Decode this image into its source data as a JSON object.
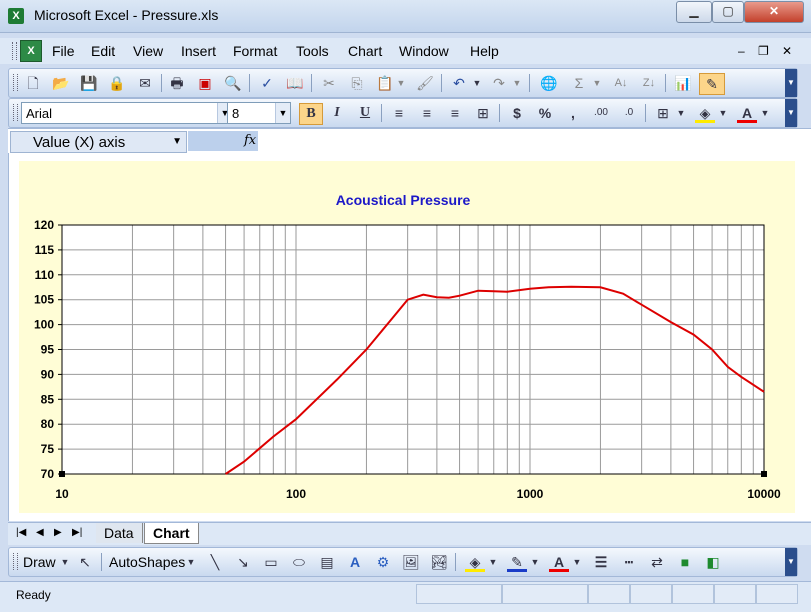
{
  "window": {
    "title": "Microsoft Excel - Pressure.xls",
    "app_icon": "X"
  },
  "menu": {
    "items": [
      {
        "label": "File",
        "u": "F",
        "rest": "ile"
      },
      {
        "label": "Edit",
        "u": "E",
        "rest": "dit"
      },
      {
        "label": "View",
        "u": "V",
        "rest": "iew"
      },
      {
        "label": "Insert",
        "u": "I",
        "rest": "nsert"
      },
      {
        "label": "Format",
        "u": "o",
        "pre": "F",
        "rest": "rmat"
      },
      {
        "label": "Tools",
        "u": "T",
        "rest": "ools"
      },
      {
        "label": "Chart",
        "u": "C",
        "rest": "hart"
      },
      {
        "label": "Window",
        "u": "W",
        "rest": "indow"
      },
      {
        "label": "Help",
        "u": "H",
        "rest": "elp"
      }
    ]
  },
  "formatting": {
    "font": "Arial",
    "size": "8"
  },
  "formula_bar": {
    "name_box": "Value (X) axis",
    "fx": "fx"
  },
  "sheets": {
    "tabs": [
      "Data",
      "Chart"
    ],
    "active": "Chart"
  },
  "drawing": {
    "draw_label": "Draw",
    "autoshapes_label": "AutoShapes"
  },
  "status": {
    "text": "Ready"
  },
  "chart_data": {
    "type": "line",
    "title": "Acoustical Pressure",
    "xlabel": "",
    "ylabel": "",
    "x_scale": "log",
    "xlim": [
      10,
      10000
    ],
    "ylim": [
      70,
      120
    ],
    "x_ticks": [
      "10",
      "100",
      "1000",
      "10000"
    ],
    "y_ticks": [
      "70",
      "75",
      "80",
      "85",
      "90",
      "95",
      "100",
      "105",
      "110",
      "115",
      "120"
    ],
    "grid": true,
    "line_color": "#dd0000",
    "plot_bg": "#ffffff",
    "series": [
      {
        "x": [
          50,
          60,
          80,
          100,
          150,
          200,
          250,
          300,
          350,
          400,
          450,
          500,
          600,
          700,
          800,
          1000,
          1200,
          1500,
          2000,
          2500,
          3000,
          4000,
          5000,
          6000,
          7000,
          8000,
          10000
        ],
        "y": [
          70,
          72.5,
          77.5,
          81,
          89,
          95,
          100.5,
          105,
          106,
          105.5,
          105.4,
          105.8,
          106.8,
          106.7,
          106.6,
          107.2,
          107.5,
          107.6,
          107.5,
          106.2,
          104,
          100.5,
          98,
          95,
          91.5,
          89.5,
          86.5
        ]
      }
    ]
  }
}
